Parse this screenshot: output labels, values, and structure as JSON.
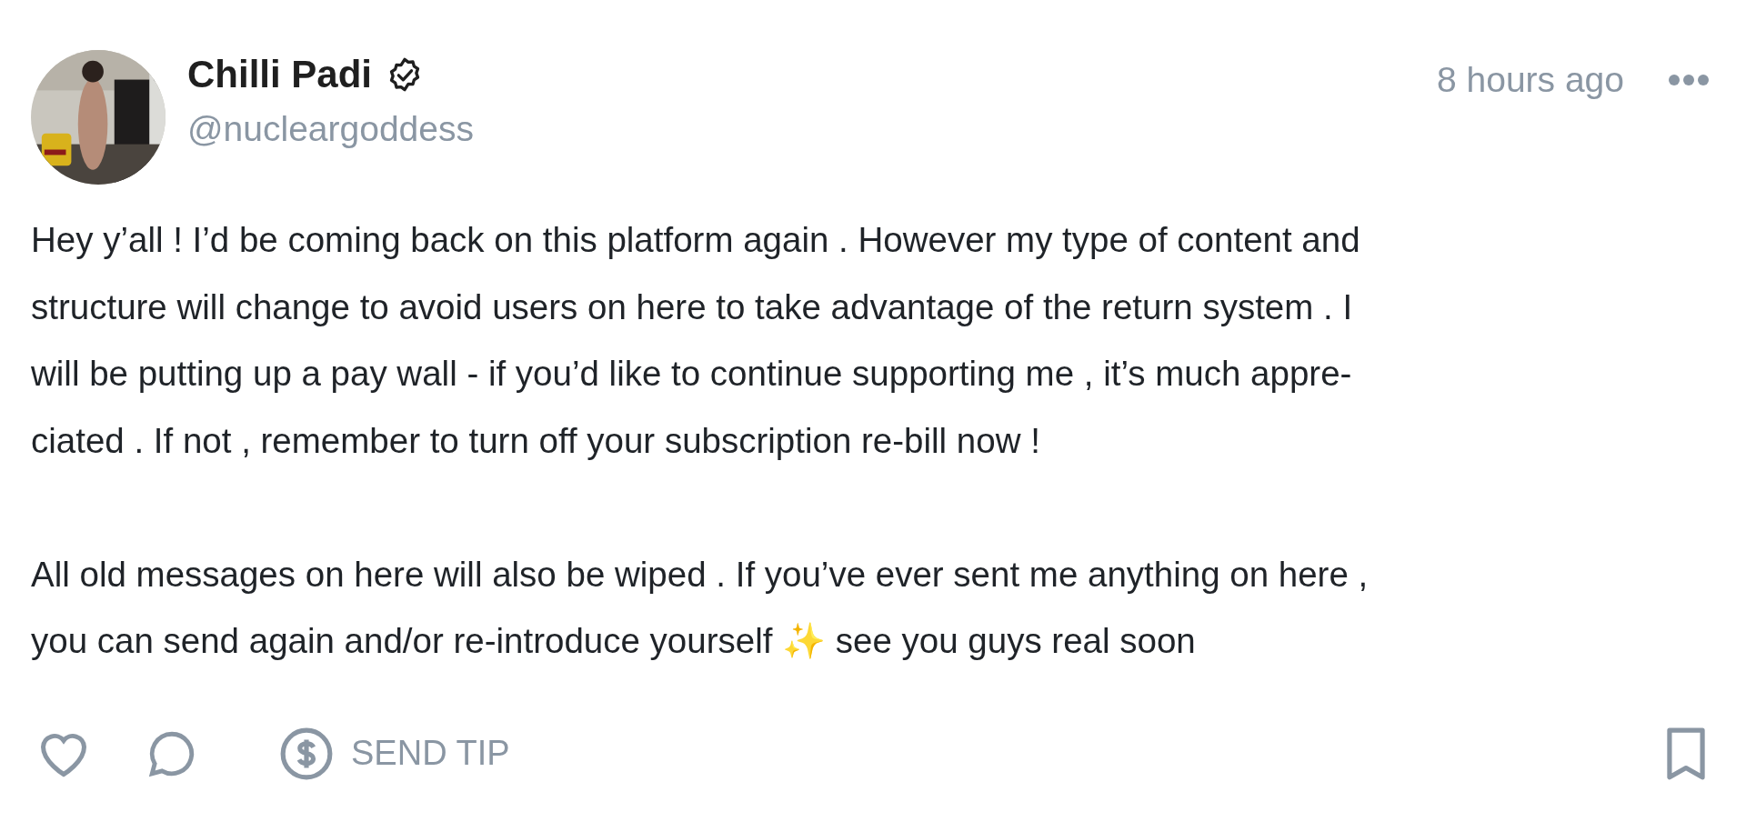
{
  "post": {
    "author": {
      "name": "Chilli Padi",
      "verified": true,
      "handle": "@nucleargoddess"
    },
    "avatar": {
      "kind": "picture"
    },
    "time": "8 hours ago",
    "paragraphs": [
      "Hey y’all ! I’d be coming back on this platform again . However my type of content and\nstructure will change to avoid users on here to take advantage of the return system . I\nwill be putting up a pay wall - if you’d like to continue supporting me , it’s much appre-\nciated . If not , remember to turn off your subscription re-bill now !",
      "All old messages on here will also be wiped . If you’ve ever sent me anything on here ,\nyou can send again and/or re-introduce yourself ✨ see you guys real soon"
    ],
    "actions": [
      {
        "kind": "like"
      },
      {
        "kind": "comment"
      },
      {
        "kind": "tip",
        "label": "SEND TIP"
      }
    ],
    "bookmarked": false
  }
}
